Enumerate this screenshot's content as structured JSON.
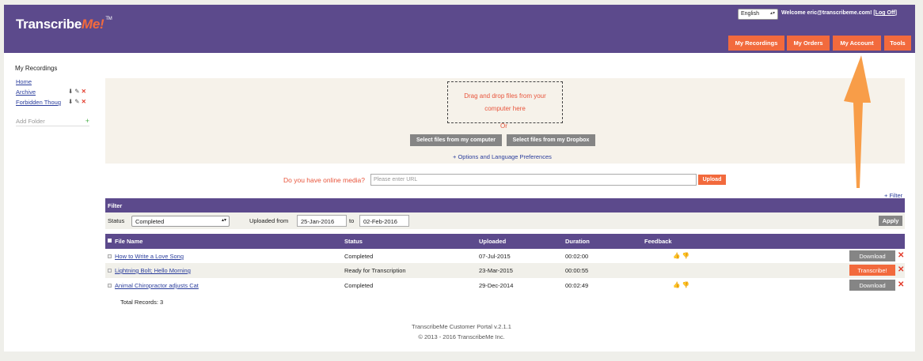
{
  "header": {
    "logo_main": "Transcribe",
    "logo_me": "Me!",
    "logo_tm": "TM",
    "language": "English",
    "welcome_text": "Welcome eric@transcribeme.com! [",
    "logoff": "Log Off",
    "welcome_end": "]",
    "nav": [
      "My Recordings",
      "My Orders",
      "My Account",
      "Tools"
    ]
  },
  "sidebar": {
    "title": "My Recordings",
    "items": [
      {
        "label": "Home"
      },
      {
        "label": "Archive"
      },
      {
        "label": "Forbidden Thoug"
      }
    ],
    "add_folder": "Add Folder"
  },
  "upload": {
    "drop_line1": "Drag and drop files from your",
    "drop_line2": "computer here",
    "or": "Or",
    "select_computer": "Select files from my computer",
    "select_dropbox": "Select files from my Dropbox",
    "options": "+ Options and Language Preferences",
    "online_label": "Do you have online media?",
    "url_placeholder": "Please enter URL",
    "upload_btn": "Upload"
  },
  "filter": {
    "toggle": "+ Filter",
    "title": "Filter",
    "status_label": "Status",
    "status_value": "Completed",
    "uploaded_from_label": "Uploaded from",
    "from_date": "25-Jan-2016",
    "to_label": "to",
    "to_date": "02-Feb-2016",
    "apply": "Apply"
  },
  "table": {
    "columns": [
      "File Name",
      "Status",
      "Uploaded",
      "Duration",
      "Feedback"
    ],
    "rows": [
      {
        "name": "How to Write a Love Song",
        "status": "Completed",
        "uploaded": "07-Jul-2015",
        "duration": "00:02:00",
        "action": "Download"
      },
      {
        "name": "Lightning Bolt; Hello Morning",
        "status": "Ready for Transcription",
        "uploaded": "23-Mar-2015",
        "duration": "00:00:55",
        "action": "Transcribe!"
      },
      {
        "name": "Animal Chiropractor adjusts Cat",
        "status": "Completed",
        "uploaded": "29-Dec-2014",
        "duration": "00:02:49",
        "action": "Download"
      }
    ],
    "total": "Total Records: 3"
  },
  "footer": {
    "version": "TranscribeMe Customer Portal v.2.1.1",
    "copyright": "© 2013 - 2016 TranscribeMe Inc."
  },
  "colors": {
    "header_purple": "#5c4a8c",
    "accent_orange": "#f26a3d",
    "annotation_arrow": "#f7963a"
  }
}
